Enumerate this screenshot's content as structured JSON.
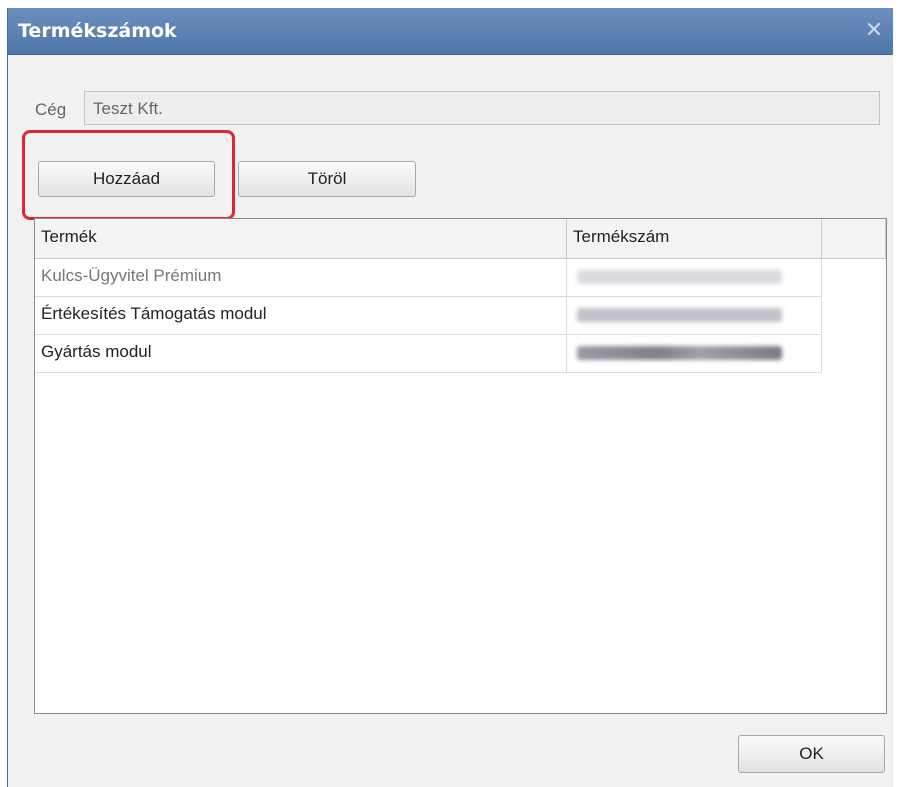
{
  "window": {
    "title": "Termékszámok",
    "close_symbol": "✕"
  },
  "company": {
    "label": "Cég",
    "value": "Teszt Kft."
  },
  "toolbar": {
    "add_label": "Hozzáad",
    "delete_label": "Töröl"
  },
  "grid": {
    "columns": [
      "Termék",
      "Termékszám"
    ],
    "rows": [
      {
        "product": "Kulcs-Ügyvitel Prémium",
        "number_redacted": true
      },
      {
        "product": "Értékesítés Támogatás modul",
        "number_redacted": true
      },
      {
        "product": "Gyártás modul",
        "number_redacted": true
      }
    ]
  },
  "footer": {
    "ok_label": "OK"
  },
  "colors": {
    "titlebar": "#4f76a8",
    "highlight": "#e0262e"
  }
}
